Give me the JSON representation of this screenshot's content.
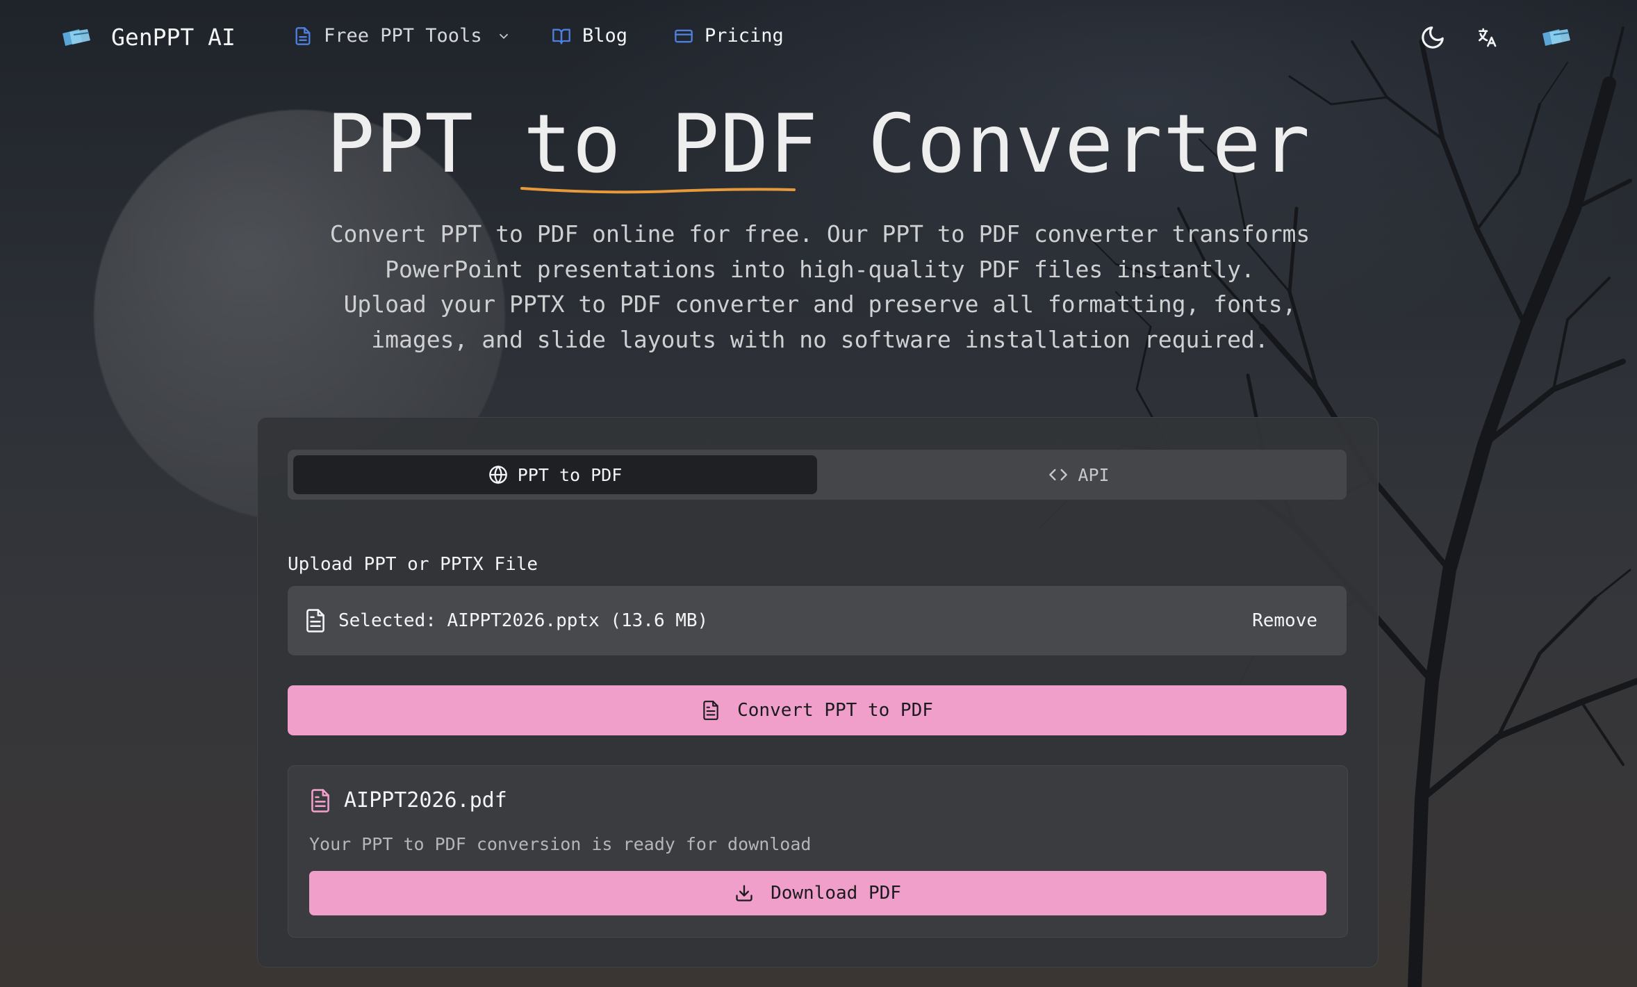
{
  "nav": {
    "brand": "GenPPT AI",
    "tools_label": "Free PPT Tools",
    "blog_label": "Blog",
    "pricing_label": "Pricing",
    "icons": [
      "logo-icon",
      "document-icon",
      "chevron-down-icon",
      "book-icon",
      "card-icon",
      "moon-icon",
      "translate-icon",
      "logo-icon"
    ]
  },
  "hero": {
    "title_before": "PPT ",
    "title_highlight": "to PDF",
    "title_after": " Converter",
    "subtitle_lines": [
      "Convert PPT to PDF online for free. Our PPT to PDF converter transforms",
      "PowerPoint presentations into high-quality PDF files instantly.",
      "Upload your PPTX to PDF converter and preserve all formatting, fonts,",
      "images, and slide layouts with no software installation required."
    ]
  },
  "tabs": {
    "converter_label": "PPT to PDF",
    "api_label": "API"
  },
  "upload": {
    "label": "Upload PPT or PPTX File",
    "selected_text": "Selected: AIPPT2026.pptx (13.6 MB)",
    "remove_label": "Remove"
  },
  "convert": {
    "button_label": "Convert PPT to PDF"
  },
  "result": {
    "file_name": "AIPPT2026.pdf",
    "message": "Your PPT to PDF conversion is ready for download",
    "download_label": "Download PDF"
  },
  "colors": {
    "accent_pink": "#f09fcb",
    "underline_orange": "#e79a3b",
    "nav_icon_blue": "#4f7fe0"
  }
}
